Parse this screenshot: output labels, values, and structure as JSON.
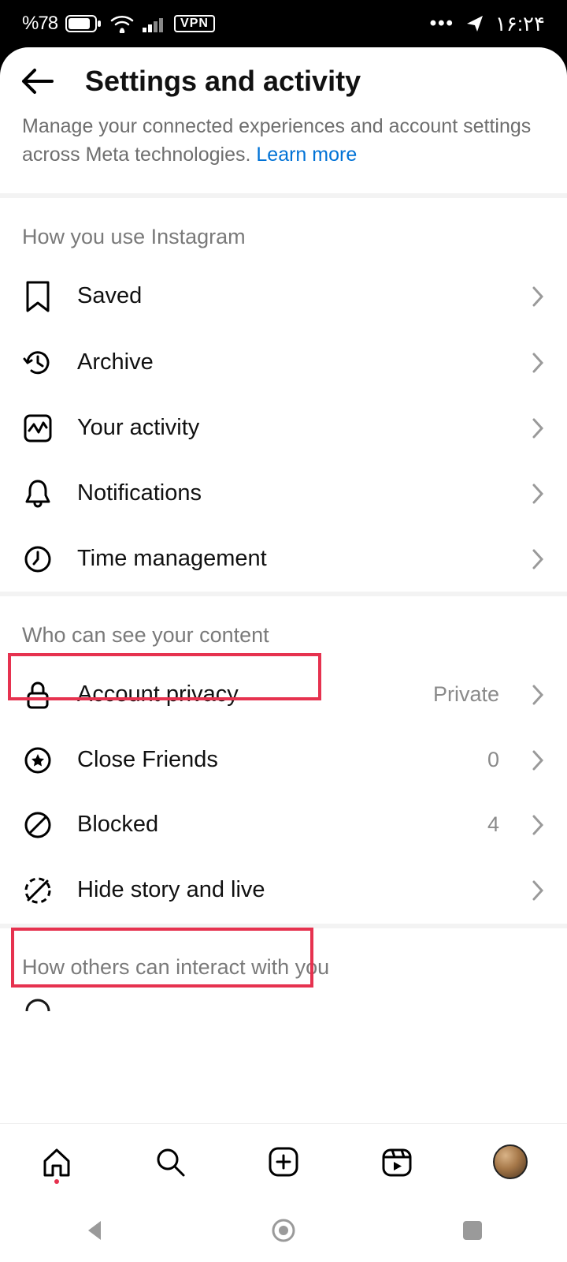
{
  "status": {
    "battery_pct": "%78",
    "vpn": "VPN",
    "time": "۱۶:۲۴"
  },
  "header": {
    "title": "Settings and activity"
  },
  "intro": {
    "text": "Manage your connected experiences and account settings across Meta technologies. ",
    "link": "Learn more"
  },
  "sections": {
    "usage": {
      "title": "How you use Instagram",
      "items": {
        "saved": "Saved",
        "archive": "Archive",
        "activity": "Your activity",
        "notifications": "Notifications",
        "time": "Time management"
      }
    },
    "visibility": {
      "title": "Who can see your content",
      "items": {
        "privacy": {
          "label": "Account privacy",
          "value": "Private"
        },
        "close_friends": {
          "label": "Close Friends",
          "value": "0"
        },
        "blocked": {
          "label": "Blocked",
          "value": "4"
        },
        "hide_story": {
          "label": "Hide story and live"
        }
      }
    },
    "interact": {
      "title": "How others can interact with you"
    }
  }
}
